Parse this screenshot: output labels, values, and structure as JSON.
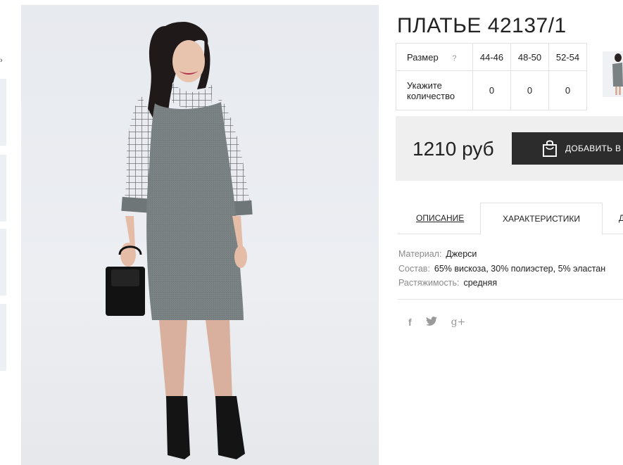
{
  "product": {
    "title": "ПЛАТЬЕ 42137/1"
  },
  "size_table": {
    "size_label": "Размер",
    "help_label": "?",
    "sizes": [
      "44-46",
      "48-50",
      "52-54"
    ],
    "quantity_label_line1": "Укажите",
    "quantity_label_line2": "количество",
    "quantities": [
      "0",
      "0",
      "0"
    ]
  },
  "purchase": {
    "price": "1210 руб",
    "add_button_label": "ДОБАВИТЬ В"
  },
  "tabs": {
    "description": "ОПИСАНИЕ",
    "characteristics": "ХАРАКТЕРИСТИКИ",
    "more": "Д"
  },
  "characteristics": [
    {
      "key": "Материал:",
      "value": "Джерси"
    },
    {
      "key": "Состав:",
      "value": "65% вискоза, 30% полиэстер, 5% эластан"
    },
    {
      "key": "Растяжимость:",
      "value": "средняя"
    }
  ],
  "social": {
    "facebook": "f",
    "twitter": "twitter-icon",
    "googleplus": "g+"
  },
  "colors": {
    "button_bg": "#2c2c2c",
    "price_box_bg": "#efefef",
    "border": "#e2e2e2"
  }
}
